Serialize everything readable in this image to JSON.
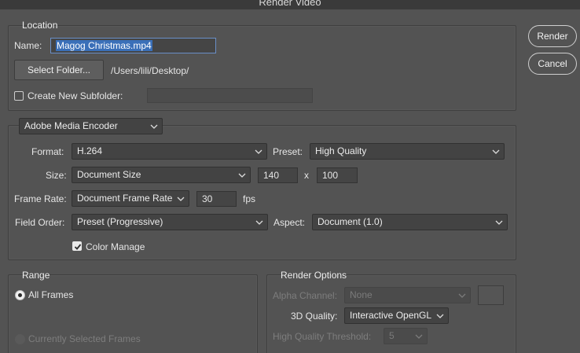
{
  "window": {
    "title": "Render Video"
  },
  "buttons": {
    "render": "Render",
    "cancel": "Cancel"
  },
  "location": {
    "header": "Location",
    "name_label": "Name:",
    "name_value": "Magog Christmas.mp4",
    "select_folder": "Select Folder...",
    "folder_path": "/Users/lili/Desktop/",
    "subfolder_label": "Create New Subfolder:",
    "subfolder_checked": false,
    "subfolder_value": ""
  },
  "encoder": {
    "selected": "Adobe Media Encoder",
    "format_label": "Format:",
    "format": "H.264",
    "preset_label": "Preset:",
    "preset": "High Quality",
    "size_label": "Size:",
    "size": "Document Size",
    "width": "140",
    "x_sep": "x",
    "height": "100",
    "frame_rate_label": "Frame Rate:",
    "frame_rate": "Document Frame Rate",
    "fps_value": "30",
    "fps_unit": "fps",
    "field_order_label": "Field Order:",
    "field_order": "Preset (Progressive)",
    "aspect_label": "Aspect:",
    "aspect": "Document (1.0)",
    "color_manage_label": "Color Manage",
    "color_manage_checked": true
  },
  "range": {
    "header": "Range",
    "all_frames": "All Frames",
    "current_frames": "Currently Selected Frames"
  },
  "render_options": {
    "header": "Render Options",
    "alpha_label": "Alpha Channel:",
    "alpha_value": "None",
    "quality_label": "3D Quality:",
    "quality_value": "Interactive OpenGL",
    "threshold_label": "High Quality Threshold:",
    "threshold_value": "5"
  },
  "icons": {
    "chevron": "chevron-down-icon",
    "checkmark": "checkmark-icon",
    "radio": "radio-dot-icon"
  },
  "colors": {
    "background": "#535353",
    "selection": "#3a6fb8"
  }
}
